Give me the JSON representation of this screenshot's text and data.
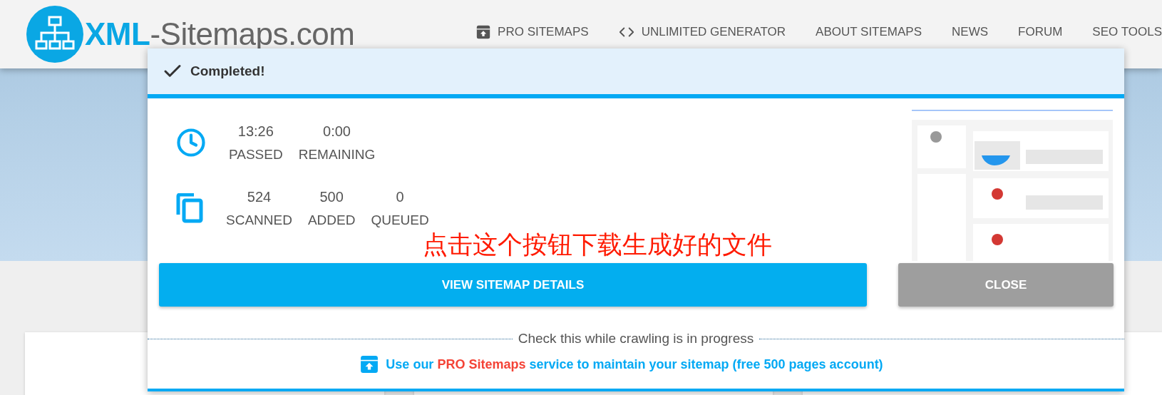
{
  "header": {
    "logo": {
      "brand": "XML",
      "rest": "-Sitemaps.com"
    },
    "nav": [
      {
        "label": "PRO SITEMAPS"
      },
      {
        "label": "UNLIMITED GENERATOR"
      },
      {
        "label": "ABOUT SITEMAPS"
      },
      {
        "label": "NEWS"
      },
      {
        "label": "FORUM"
      },
      {
        "label": "SEO TOOLS"
      }
    ]
  },
  "dialog": {
    "title": "Completed!",
    "stats": [
      {
        "kind": "time",
        "items": [
          {
            "value": "13:26",
            "label": "PASSED"
          },
          {
            "value": "0:00",
            "label": "REMAINING"
          }
        ]
      },
      {
        "kind": "pages",
        "items": [
          {
            "value": "524",
            "label": "SCANNED"
          },
          {
            "value": "500",
            "label": "ADDED"
          },
          {
            "value": "0",
            "label": "QUEUED"
          }
        ]
      }
    ],
    "annotation": "点击这个按钮下载生成好的文件",
    "buttons": [
      {
        "label": "VIEW SITEMAP DETAILS",
        "kind": "primary"
      },
      {
        "label": "CLOSE",
        "kind": "secondary"
      }
    ],
    "divider_text": "Check this while crawling is in progress",
    "promo": [
      {
        "text": "Use our ",
        "highlight": false
      },
      {
        "text": "PRO Sitemaps",
        "highlight": true
      },
      {
        "text": " service to maintain your sitemap (free 500 pages account)",
        "highlight": false
      }
    ]
  }
}
